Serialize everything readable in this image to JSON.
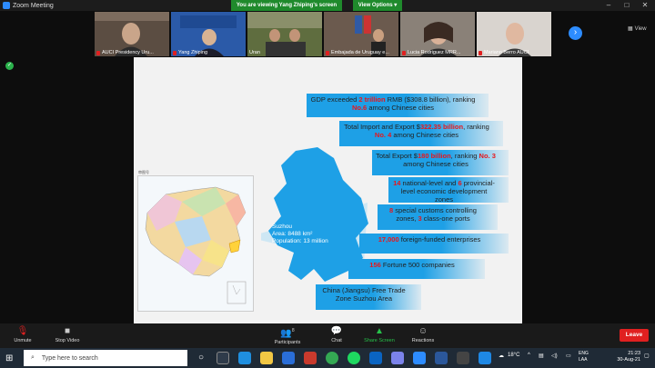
{
  "window": {
    "title": "Zoom Meeting",
    "viewing_banner": "You are viewing Yang Zhiping's screen",
    "view_options": "View Options"
  },
  "gallery": {
    "tiles": [
      {
        "name": "AUCI Presidency Uru..."
      },
      {
        "name": "Yang Zhiping"
      },
      {
        "name": "Uran"
      },
      {
        "name": "Embajada de Uruguay e..."
      },
      {
        "name": "Lucia Rodriguez MRR..."
      },
      {
        "name": "Mariano Berro AUCI"
      }
    ],
    "view_label": "View"
  },
  "slide": {
    "map_caption": "审图号",
    "suzhou": {
      "line1": "Suzhou",
      "line2": "Area: 8488 km²",
      "line3": "Population: 13 million"
    },
    "stats": [
      {
        "pre": "GDP exceeded ",
        "hl": "2 trillion",
        "post": " RMB ($308.8 billion), ranking ",
        "hl2": "No.6",
        "post2": " among Chinese cities"
      },
      {
        "pre": "Total Import and Export $",
        "hl": "322.35 billion",
        "post": ", ranking ",
        "hl2": "No. 4",
        "post2": " among Chinese cities"
      },
      {
        "pre": "Total Export $",
        "hl": "180 billion",
        "post": ", ranking ",
        "hl2": "No. 3",
        "post2": " among Chinese cities"
      },
      {
        "pre": "",
        "hl": "14",
        "post": " national-level and ",
        "hl2": "6",
        "post2": " provincial-level economic development zones"
      },
      {
        "pre": "",
        "hl": "8",
        "post": " special customs controlling zones, ",
        "hl2": "3",
        "post2": " class-one ports"
      },
      {
        "pre": "",
        "hl": "17,000",
        "post": " foreign-funded enterprises",
        "hl2": "",
        "post2": ""
      },
      {
        "pre": "",
        "hl": "156",
        "post": " Fortune 500 companies",
        "hl2": "",
        "post2": ""
      },
      {
        "pre": "China (Jiangsu) Free Trade Zone Suzhou Area",
        "hl": "",
        "post": "",
        "hl2": "",
        "post2": ""
      }
    ]
  },
  "controls": {
    "unmute": "Unmute",
    "stop_video": "Stop Video",
    "participants": "Participants",
    "participants_count": "8",
    "chat": "Chat",
    "share_screen": "Share Screen",
    "reactions": "Reactions",
    "leave": "Leave"
  },
  "taskbar": {
    "search_placeholder": "Type here to search",
    "weather": "18°C",
    "lang": "ENG",
    "lang2": "LAA",
    "time": "21:23",
    "date": "30-Aug-21"
  },
  "colors": {
    "accent_blue": "#2d8cff",
    "banner_green": "#1f8a2c",
    "leave_red": "#e02020",
    "slide_blue": "#1ea0e6",
    "highlight_red": "#e8161b"
  }
}
